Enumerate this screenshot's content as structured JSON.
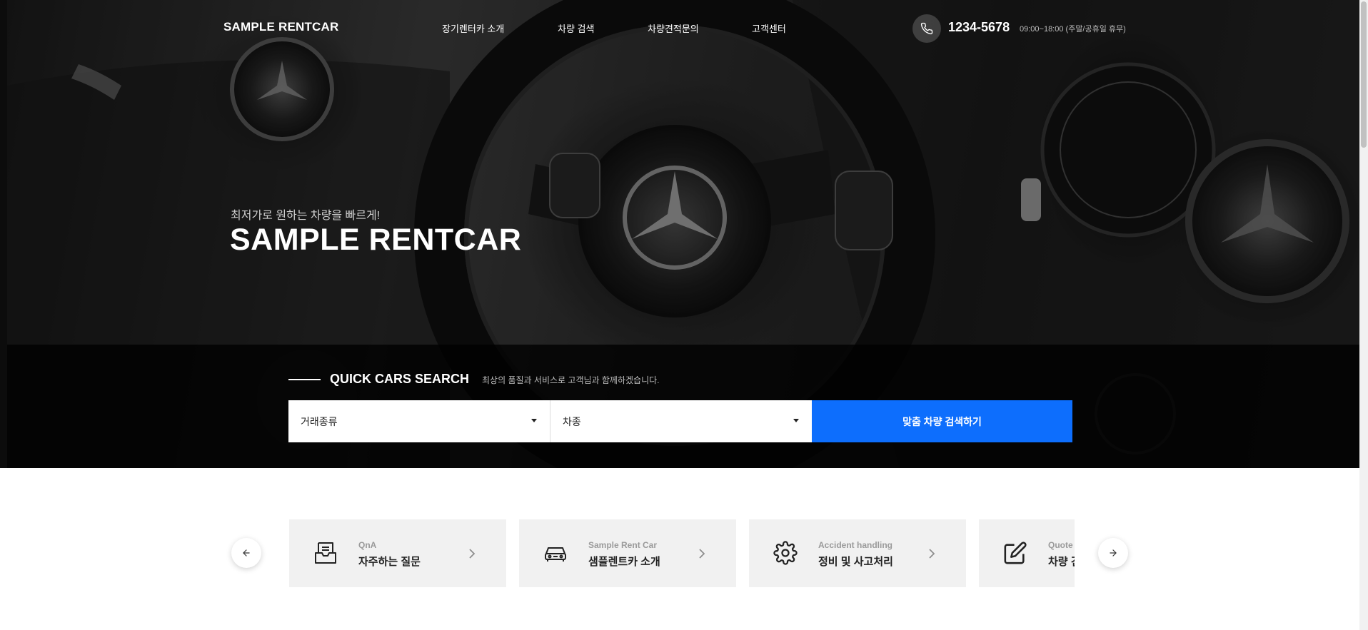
{
  "header": {
    "logo": "SAMPLE RENTCAR",
    "nav": [
      "장기렌터카 소개",
      "차량 검색",
      "차량견적문의",
      "고객센터"
    ],
    "phone_icon": "phone-icon",
    "phone_number": "1234-5678",
    "phone_hours": "09:00~18:00 (주말/공휴일 휴무)"
  },
  "hero": {
    "subtitle": "최저가로 원하는 차량을 빠르게!",
    "title": "SAMPLE RENTCAR"
  },
  "quick_search": {
    "title": "QUICK CARS SEARCH",
    "description": "최상의 품질과 서비스로 고객님과 함께하겠습니다.",
    "select_trade": "거래종류",
    "select_car": "차종",
    "button": "맞춤 차량 검색하기"
  },
  "carousel": {
    "prev_icon": "arrow-left-icon",
    "next_icon": "arrow-right-icon",
    "cards": [
      {
        "en": "QnA",
        "ko": "자주하는 질문",
        "icon": "inbox-icon"
      },
      {
        "en": "Sample Rent Car",
        "ko": "샘플렌트카 소개",
        "icon": "car-icon"
      },
      {
        "en": "Accident handling",
        "ko": "정비 및 사고처리",
        "icon": "gear-icon"
      },
      {
        "en": "Quote",
        "ko": "차량 견적문의",
        "icon": "edit-icon"
      }
    ]
  },
  "colors": {
    "accent": "#0d6efd",
    "card_bg": "#f1f1f1",
    "hero_overlay": "#000000"
  }
}
